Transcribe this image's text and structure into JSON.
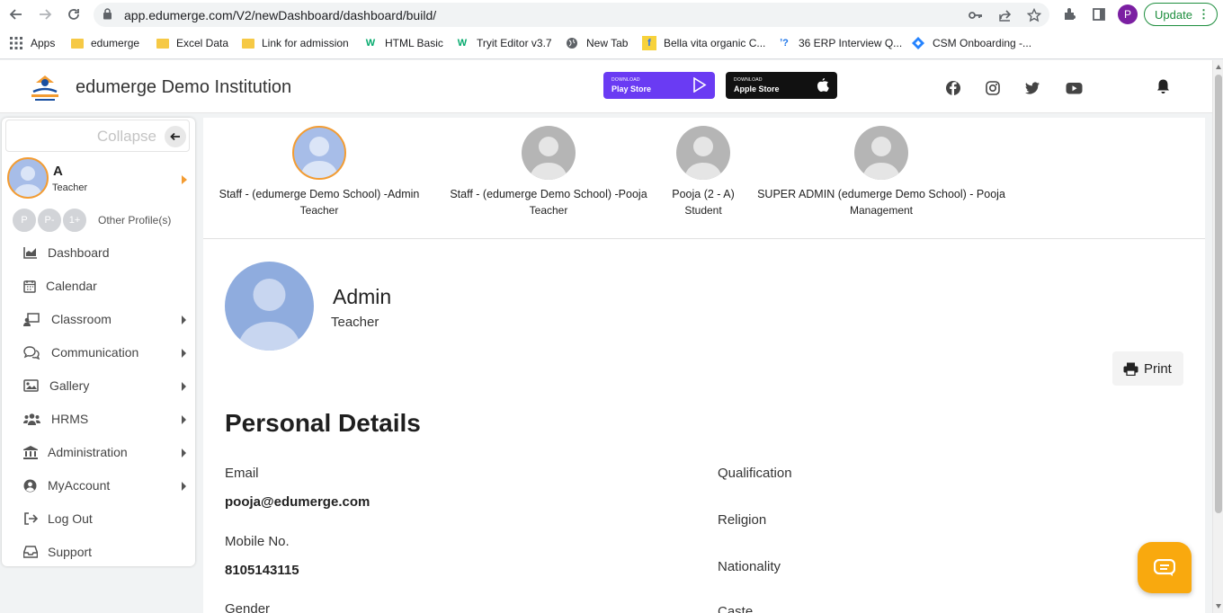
{
  "browser": {
    "url": "app.edumerge.com/V2/newDashboard/dashboard/build/",
    "profile_initial": "P",
    "update_label": "Update",
    "bookmarks": [
      {
        "label": "Apps",
        "icon": "apps-grid-icon"
      },
      {
        "label": "edumerge",
        "icon": "folder-icon"
      },
      {
        "label": "Excel Data",
        "icon": "folder-icon"
      },
      {
        "label": "Link for admission",
        "icon": "folder-icon"
      },
      {
        "label": "HTML Basic",
        "icon": "w3schools-icon"
      },
      {
        "label": "Tryit Editor v3.7",
        "icon": "w3schools-icon"
      },
      {
        "label": "New Tab",
        "icon": "globe-icon"
      },
      {
        "label": "Bella vita organic C...",
        "icon": "flipkart-icon"
      },
      {
        "label": "36 ERP Interview Q...",
        "icon": "question-icon"
      },
      {
        "label": "CSM Onboarding -...",
        "icon": "diamond-icon"
      }
    ]
  },
  "header": {
    "institution": "edumerge Demo Institution",
    "play_store": {
      "small": "DOWNLOAD",
      "big": "Play Store",
      "color": "#6a3bf3"
    },
    "apple_store": {
      "small": "DOWNLOAD",
      "big": "Apple Store",
      "color": "#111111"
    },
    "socials": [
      "facebook-icon",
      "instagram-icon",
      "twitter-icon",
      "youtube-icon"
    ]
  },
  "sidebar": {
    "collapse_label": "Collapse",
    "user": {
      "name": "A",
      "role": "Teacher"
    },
    "other_profiles": {
      "circles": [
        "P",
        "P-",
        "1+"
      ],
      "label": "Other Profile(s)"
    },
    "items": [
      {
        "label": "Dashboard",
        "icon": "chart-icon",
        "has_caret": false
      },
      {
        "label": "Calendar",
        "icon": "calendar-icon",
        "has_caret": false
      },
      {
        "label": "Classroom",
        "icon": "classroom-icon",
        "has_caret": true
      },
      {
        "label": "Communication",
        "icon": "chat-icon",
        "has_caret": true
      },
      {
        "label": "Gallery",
        "icon": "image-icon",
        "has_caret": true
      },
      {
        "label": "HRMS",
        "icon": "users-icon",
        "has_caret": true
      },
      {
        "label": "Administration",
        "icon": "bank-icon",
        "has_caret": true
      },
      {
        "label": "MyAccount",
        "icon": "user-circle-icon",
        "has_caret": true
      },
      {
        "label": "Log Out",
        "icon": "logout-icon",
        "has_caret": false
      },
      {
        "label": "Support",
        "icon": "inbox-icon",
        "has_caret": false
      }
    ]
  },
  "profiles": [
    {
      "name": "Staff - (edumerge Demo School) -Admin",
      "role": "Teacher",
      "active": true
    },
    {
      "name": "Staff - (edumerge Demo School) -Pooja",
      "role": "Teacher",
      "active": false
    },
    {
      "name": "Pooja (2 - A)",
      "role": "Student",
      "active": false
    },
    {
      "name": "SUPER ADMIN (edumerge Demo School) - Pooja",
      "role": "Management",
      "active": false
    }
  ],
  "profile": {
    "name": "Admin",
    "role": "Teacher",
    "print_label": "Print",
    "section_title": "Personal Details",
    "fields_left": [
      {
        "label": "Email",
        "value": "pooja@edumerge.com"
      },
      {
        "label": "Mobile No.",
        "value": "8105143115"
      },
      {
        "label": "Gender",
        "value": ""
      }
    ],
    "fields_right": [
      {
        "label": "Qualification",
        "value": ""
      },
      {
        "label": "Religion",
        "value": ""
      },
      {
        "label": "Nationality",
        "value": ""
      },
      {
        "label": "Caste",
        "value": ""
      }
    ]
  },
  "colors": {
    "accent": "#f39c32",
    "chat": "#f9a90e",
    "avatar_blue": "#8facde"
  }
}
